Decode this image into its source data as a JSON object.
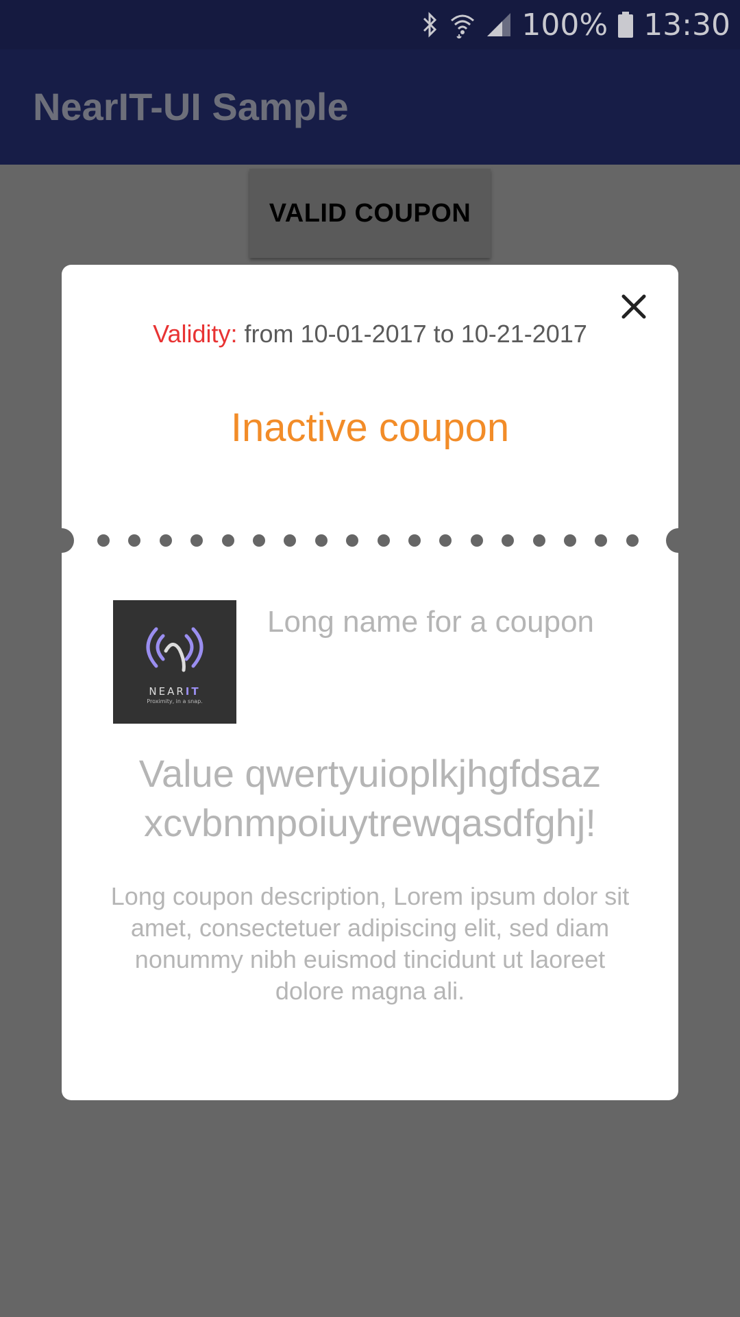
{
  "status_bar": {
    "battery_percent": "100%",
    "time": "13:30",
    "icons": [
      "bluetooth-icon",
      "wifi-icon",
      "signal-icon",
      "battery-icon"
    ]
  },
  "app_bar": {
    "title": "NearIT-UI Sample"
  },
  "background": {
    "button_label": "VALID COUPON"
  },
  "dialog": {
    "close_icon": "close-icon",
    "validity_label": "Validity:",
    "validity_range": " from 10-01-2017 to 10-21-2017",
    "status": "Inactive coupon",
    "logo": {
      "word_part1": "NEAR",
      "word_part2": "IT",
      "tagline": "Proximity, in a snap."
    },
    "coupon_name": "Long name for a coupon",
    "coupon_value": "Value qwertyuioplkjhgfdsaz xcvbnmpoiuytrewqasdfghj!",
    "coupon_description": "Long coupon description, Lorem ipsum dolor sit amet, consectetuer adipiscing elit, sed diam nonummy nibh euismod tincidunt ut laoreet dolore magna ali."
  },
  "colors": {
    "status_bar": "#151a40",
    "app_bar": "#171d47",
    "scrim": "#666666",
    "validity_label": "#e83333",
    "status_text": "#f28c28",
    "logo_accent": "#9a8ef0"
  }
}
